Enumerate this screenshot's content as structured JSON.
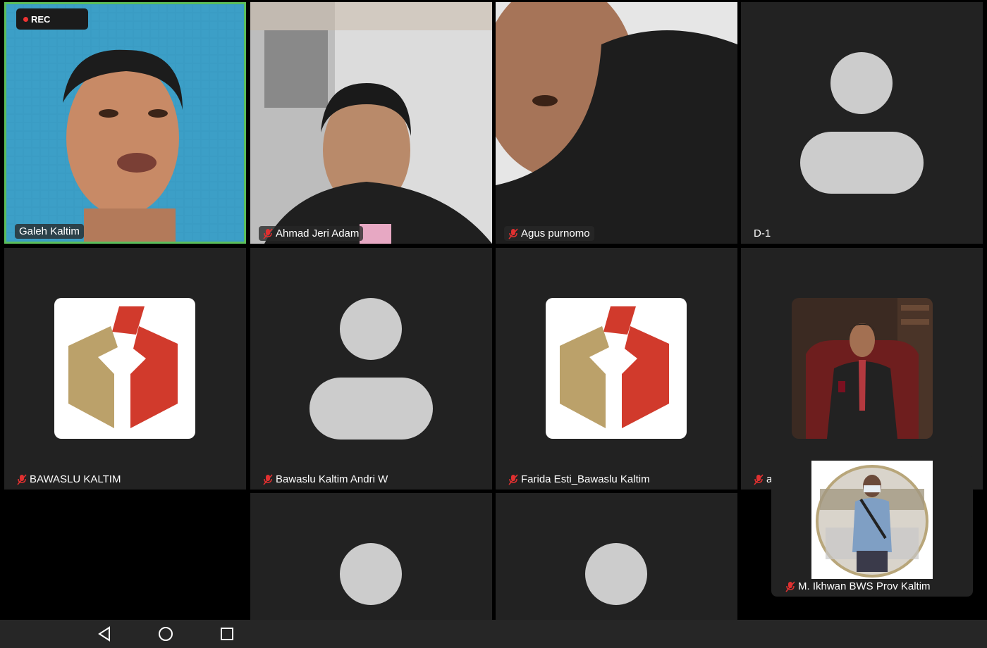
{
  "recording": {
    "label": "REC"
  },
  "colors": {
    "active_border": "#5bbd5b",
    "tile_bg": "#222222",
    "rec_dot": "#ee3333",
    "mute_red": "#e03030"
  },
  "participants": [
    {
      "name": "Galeh Kaltim",
      "muted": false,
      "type": "video"
    },
    {
      "name": "Ahmad Jeri Adam",
      "muted": true,
      "type": "video"
    },
    {
      "name": "Agus purnomo",
      "muted": true,
      "type": "video"
    },
    {
      "name": "D-1",
      "muted": false,
      "type": "avatar"
    },
    {
      "name": "BAWASLU KALTIM",
      "muted": true,
      "type": "logo"
    },
    {
      "name": "Bawaslu Kaltim Andri W",
      "muted": true,
      "type": "avatar"
    },
    {
      "name": "Farida Esti_Bawaslu Kaltim",
      "muted": true,
      "type": "logo"
    },
    {
      "name": "a",
      "muted": true,
      "type": "photo"
    },
    {
      "name": "",
      "muted": false,
      "type": "avatar"
    },
    {
      "name": "",
      "muted": false,
      "type": "avatar"
    }
  ],
  "pip": {
    "name": "M. Ikhwan BWS Prov Kaltim",
    "muted": true
  },
  "navigation": {
    "icons": [
      "back-triangle-icon",
      "home-circle-icon",
      "recents-square-icon"
    ]
  }
}
